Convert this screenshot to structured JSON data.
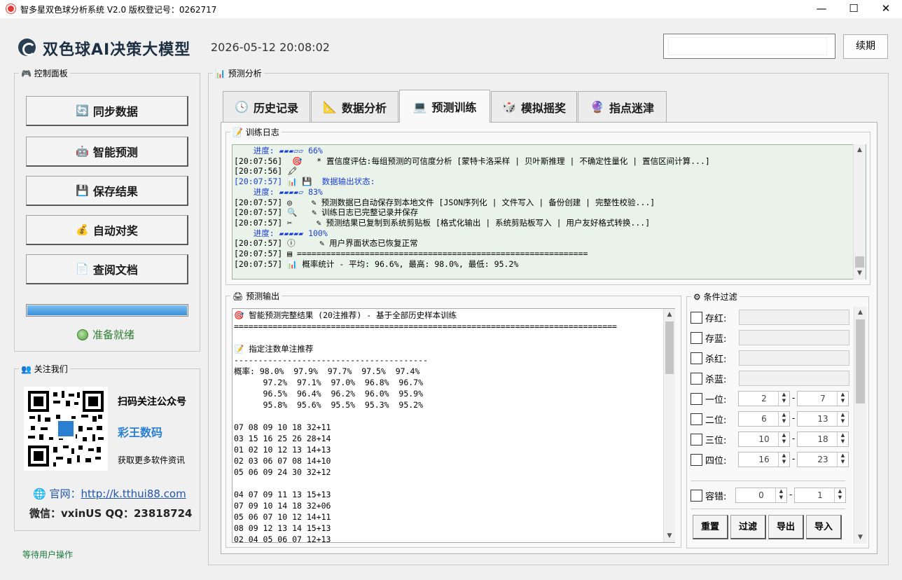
{
  "window": {
    "title": "智多星双色球分析系统 V2.0    版权登记号：0262717",
    "min": "—",
    "max": "☐",
    "close": "✕"
  },
  "header": {
    "title": "双色球AI决策大模型",
    "datetime": "2026-05-12 20:08:02",
    "renew_label": "续期"
  },
  "control_panel": {
    "legend": "控制面板",
    "buttons": [
      {
        "label": "同步数据",
        "icon": "sync-icon"
      },
      {
        "label": "智能预测",
        "icon": "robot-icon"
      },
      {
        "label": "保存结果",
        "icon": "save-icon"
      },
      {
        "label": "自动对奖",
        "icon": "money-bag-icon"
      },
      {
        "label": "查阅文档",
        "icon": "document-icon"
      }
    ],
    "progress": 1.0,
    "status": "准备就绪"
  },
  "follow": {
    "legend": "关注我们",
    "title": "扫码关注公众号",
    "name": "彩王数码",
    "subtitle": "获取更多软件资讯",
    "website": "官网：",
    "website_url": "http://k.tthui88.com",
    "contacts": "微信：vxinUS   QQ：23818724"
  },
  "status_bar": "等待用户操作",
  "analysis": {
    "legend": "预测分析",
    "tabs": [
      {
        "label": "历史记录",
        "icon": "clock-icon"
      },
      {
        "label": "数据分析",
        "icon": "chart-icon"
      },
      {
        "label": "预测训练",
        "icon": "laptop-icon"
      },
      {
        "label": "模拟摇奖",
        "icon": "cube-icon"
      },
      {
        "label": "指点迷津",
        "icon": "fortune-icon"
      }
    ],
    "log_legend": "训练日志",
    "log": [
      {
        "text": "    进度: ▰▰▰▱▱ 66%",
        "blue": true
      },
      {
        "text": "[20:07:56]  🎯   * 置信度评估:每组预测的可信度分析 [蒙特卡洛采样 | 贝叶斯推理 | 不确定性量化 | 置信区间计算...]",
        "blue": false
      },
      {
        "text": "[20:07:56] 🖍",
        "blue": false
      },
      {
        "text": "[20:07:57] 📊 💾  数据输出状态:",
        "blue": true
      },
      {
        "text": "    进度: ▰▰▰▰▱ 83%",
        "blue": true
      },
      {
        "text": "[20:07:57] ◎    ✎ 预测数据已自动保存到本地文件 [JSON序列化 | 文件写入 | 备份创建 | 完整性校验...]",
        "blue": false
      },
      {
        "text": "[20:07:57] 🔍   ✎ 训练日志已完整记录并保存",
        "blue": false
      },
      {
        "text": "[20:07:57] ✂     ✎ 预测结果已复制到系统剪贴板 [格式化输出 | 系统剪贴板写入 | 用户友好格式转换...]",
        "blue": false
      },
      {
        "text": "    进度: ▰▰▰▰▰ 100%",
        "blue": true
      },
      {
        "text": "[20:07:57] ⓘ     ✎ 用户界面状态已恢复正常",
        "blue": false
      },
      {
        "text": "[20:07:57] ▤ ============================================================",
        "blue": false
      },
      {
        "text": "[20:07:57] 📊 概率统计 - 平均: 96.6%, 最高: 98.0%, 最低: 95.2%",
        "blue": false
      }
    ],
    "output_legend": "预测输出",
    "output": [
      "🎯 智能预测完整结果 (20注推荐) - 基于全部历史样本训练",
      "===============================================================================",
      "",
      "📝 指定注数单注推荐",
      "----------------------------------------",
      "概率: 98.0%  97.9%  97.7%  97.5%  97.4%",
      "      97.2%  97.1%  97.0%  96.8%  96.7%",
      "      96.5%  96.4%  96.2%  96.0%  95.9%",
      "      95.8%  95.6%  95.5%  95.3%  95.2%",
      "",
      "07 08 09 10 18 32+11",
      "03 15 16 25 26 28+14",
      "01 02 10 12 13 14+13",
      "02 03 06 07 08 14+10",
      "05 06 09 24 30 32+12",
      "",
      "04 07 09 11 13 15+13",
      "07 09 10 14 18 32+06",
      "05 06 07 10 12 14+11",
      "08 09 12 13 14 15+13",
      "02 04 05 06 07 12+13"
    ],
    "filter": {
      "legend": "条件过滤",
      "text_rows": [
        {
          "label": "存红:"
        },
        {
          "label": "存蓝:"
        },
        {
          "label": "杀红:"
        },
        {
          "label": "杀蓝:"
        }
      ],
      "range_rows": [
        {
          "label": "一位:",
          "from": "2",
          "to": "7"
        },
        {
          "label": "二位:",
          "from": "6",
          "to": "13"
        },
        {
          "label": "三位:",
          "from": "10",
          "to": "18"
        },
        {
          "label": "四位:",
          "from": "16",
          "to": "23"
        }
      ],
      "tolerance": {
        "label": "容错:",
        "from": "0",
        "to": "1"
      },
      "buttons": [
        "重置",
        "过滤",
        "导出",
        "导入"
      ]
    }
  }
}
